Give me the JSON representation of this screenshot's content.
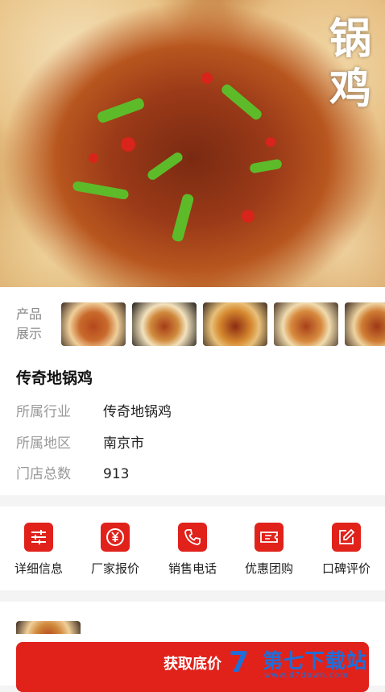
{
  "hero": {
    "calligraphy_top": "锅",
    "calligraphy_bottom": "鸡"
  },
  "showcase": {
    "label_line1": "产品",
    "label_line2": "展示",
    "thumbnails": [
      "food-photo-1",
      "food-photo-2",
      "food-photo-3",
      "food-photo-4",
      "food-photo-5"
    ]
  },
  "brand": {
    "name": "传奇地锅鸡",
    "industry_label": "所属行业",
    "industry_value": "传奇地锅鸡",
    "region_label": "所属地区",
    "region_value": "南京市",
    "stores_label": "门店总数",
    "stores_value": "913"
  },
  "actions": [
    {
      "label": "详细信息",
      "icon": "sliders-icon"
    },
    {
      "label": "厂家报价",
      "icon": "yen-icon"
    },
    {
      "label": "销售电话",
      "icon": "phone-icon"
    },
    {
      "label": "优惠团购",
      "icon": "ticket-icon"
    },
    {
      "label": "口碑评价",
      "icon": "edit-icon"
    }
  ],
  "cta": {
    "label": "获取底价"
  },
  "watermark": {
    "title": "第七下载站",
    "url": "www.d7down.com",
    "logo": "7"
  },
  "colors": {
    "accent": "#e0221b",
    "watermark": "#1e6fd9"
  }
}
